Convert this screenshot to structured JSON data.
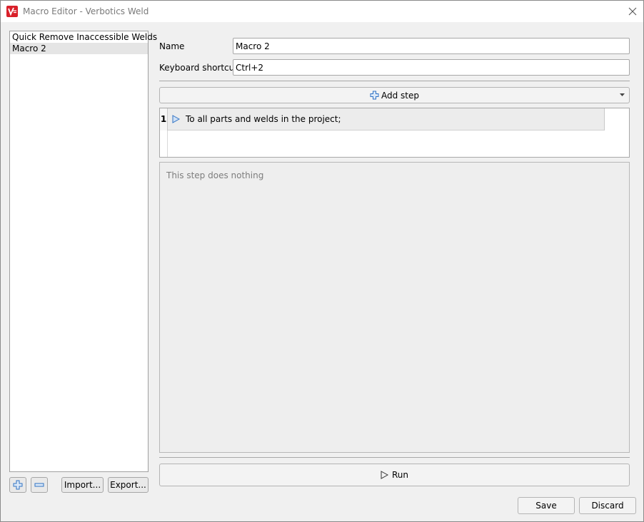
{
  "window": {
    "title": "Macro Editor - Verbotics Weld",
    "close_icon": "close-icon",
    "logo_icon": "verbotics-logo-icon"
  },
  "sidebar": {
    "macros": [
      {
        "label": "Quick Remove Inaccessible Welds",
        "selected": false
      },
      {
        "label": "Macro 2",
        "selected": true
      }
    ],
    "add_icon": "plus-icon",
    "remove_icon": "minus-icon",
    "import_label": "Import...",
    "export_label": "Export..."
  },
  "form": {
    "name_label": "Name",
    "name_value": "Macro 2",
    "shortcut_label": "Keyboard shortcut",
    "shortcut_value": "Ctrl+2"
  },
  "steps": {
    "add_step_label": "Add step",
    "add_icon": "plus-icon",
    "dropdown_icon": "chevron-down-icon",
    "rows": [
      {
        "number": "1",
        "text": "To all parts and welds in the project;",
        "icon": "play-icon"
      }
    ],
    "detail_text": "This step does nothing"
  },
  "actions": {
    "run_label": "Run",
    "run_icon": "play-icon",
    "save_label": "Save",
    "discard_label": "Discard"
  },
  "colors": {
    "accent_blue": "#2f72c4",
    "logo_red": "#d9202a",
    "selected_row": "#e5e5e5"
  }
}
